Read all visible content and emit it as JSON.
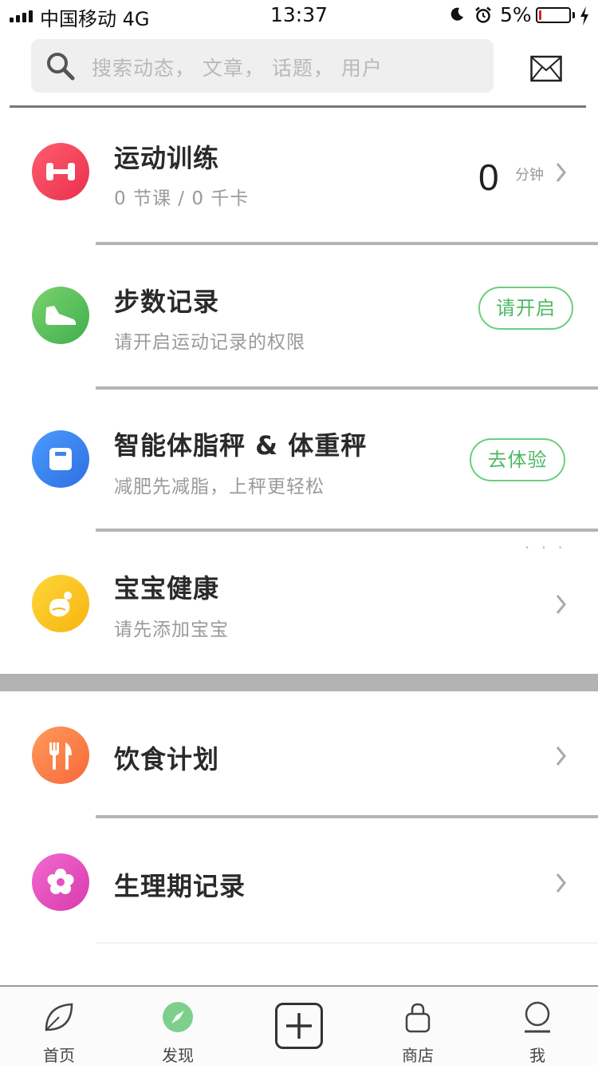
{
  "status_bar": {
    "carrier": "中国移动",
    "network": "4G",
    "time": "13:37",
    "battery_percent": "5%"
  },
  "search": {
    "placeholder": "搜索动态， 文章， 话题， 用户"
  },
  "rows": {
    "training": {
      "title": "运动训练",
      "subtitle": "0 节课 / 0 千卡",
      "value": "0",
      "unit": "分钟",
      "icon": "dumbbell-icon",
      "color": "#f0465a"
    },
    "steps": {
      "title": "步数记录",
      "subtitle": "请开启运动记录的权限",
      "button": "请开启",
      "icon": "shoe-icon",
      "color": "#5cc05e"
    },
    "scale": {
      "title": "智能体脂秤 & 体重秤",
      "subtitle": "减肥先减脂，上秤更轻松",
      "button": "去体验",
      "icon": "scale-icon",
      "color": "#3a86f0"
    },
    "baby": {
      "title": "宝宝健康",
      "subtitle": "请先添加宝宝",
      "icon": "baby-bottle-icon",
      "color": "#fbc21f"
    },
    "diet": {
      "title": "饮食计划",
      "icon": "fork-knife-icon",
      "color": "#ff7d4a"
    },
    "period": {
      "title": "生理期记录",
      "icon": "flower-icon",
      "color": "#e84fc1"
    }
  },
  "more_dots": "· · ·",
  "tab_bar": {
    "home": "首页",
    "discover": "发现",
    "shop": "商店",
    "me": "我"
  },
  "accent_color": "#5cc07a"
}
